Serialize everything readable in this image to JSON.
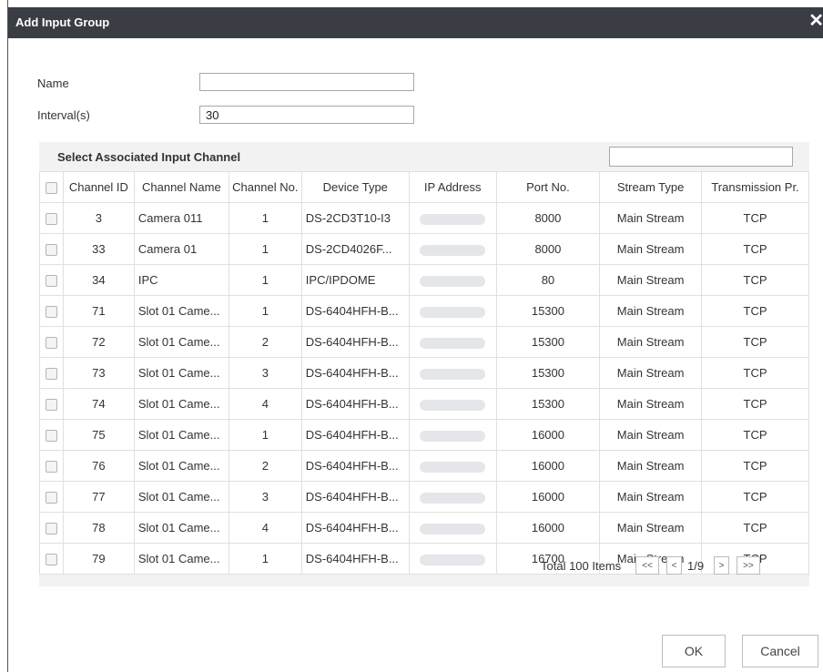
{
  "dialog": {
    "title": "Add Input Group",
    "close_glyph": "✕"
  },
  "form": {
    "name_label": "Name",
    "name_value": "",
    "interval_label": "Interval(s)",
    "interval_value": "30"
  },
  "panel": {
    "title": "Select Associated Input Channel",
    "search_value": ""
  },
  "table": {
    "columns": [
      "Channel ID",
      "Channel Name",
      "Channel No.",
      "Device Type",
      "IP Address",
      "Port No.",
      "Stream Type",
      "Transmission Pr."
    ],
    "rows": [
      {
        "id": "3",
        "name": "Camera 011",
        "no": "1",
        "device": "DS-2CD3T10-I3",
        "port": "8000",
        "stream": "Main Stream",
        "trans": "TCP"
      },
      {
        "id": "33",
        "name": "Camera 01",
        "no": "1",
        "device": "DS-2CD4026F...",
        "port": "8000",
        "stream": "Main Stream",
        "trans": "TCP"
      },
      {
        "id": "34",
        "name": "IPC",
        "no": "1",
        "device": "IPC/IPDOME",
        "port": "80",
        "stream": "Main Stream",
        "trans": "TCP"
      },
      {
        "id": "71",
        "name": "Slot 01 Came...",
        "no": "1",
        "device": "DS-6404HFH-B...",
        "port": "15300",
        "stream": "Main Stream",
        "trans": "TCP"
      },
      {
        "id": "72",
        "name": "Slot 01 Came...",
        "no": "2",
        "device": "DS-6404HFH-B...",
        "port": "15300",
        "stream": "Main Stream",
        "trans": "TCP"
      },
      {
        "id": "73",
        "name": "Slot 01 Came...",
        "no": "3",
        "device": "DS-6404HFH-B...",
        "port": "15300",
        "stream": "Main Stream",
        "trans": "TCP"
      },
      {
        "id": "74",
        "name": "Slot 01 Came...",
        "no": "4",
        "device": "DS-6404HFH-B...",
        "port": "15300",
        "stream": "Main Stream",
        "trans": "TCP"
      },
      {
        "id": "75",
        "name": "Slot 01 Came...",
        "no": "1",
        "device": "DS-6404HFH-B...",
        "port": "16000",
        "stream": "Main Stream",
        "trans": "TCP"
      },
      {
        "id": "76",
        "name": "Slot 01 Came...",
        "no": "2",
        "device": "DS-6404HFH-B...",
        "port": "16000",
        "stream": "Main Stream",
        "trans": "TCP"
      },
      {
        "id": "77",
        "name": "Slot 01 Came...",
        "no": "3",
        "device": "DS-6404HFH-B...",
        "port": "16000",
        "stream": "Main Stream",
        "trans": "TCP"
      },
      {
        "id": "78",
        "name": "Slot 01 Came...",
        "no": "4",
        "device": "DS-6404HFH-B...",
        "port": "16000",
        "stream": "Main Stream",
        "trans": "TCP"
      },
      {
        "id": "79",
        "name": "Slot 01 Came...",
        "no": "1",
        "device": "DS-6404HFH-B...",
        "port": "16700",
        "stream": "Main Stream",
        "trans": "TCP"
      }
    ]
  },
  "pager": {
    "total": "Total 100 Items",
    "first": "<<",
    "prev": "<",
    "page": "1/9",
    "next": ">",
    "last": ">>"
  },
  "buttons": {
    "ok": "OK",
    "cancel": "Cancel"
  }
}
